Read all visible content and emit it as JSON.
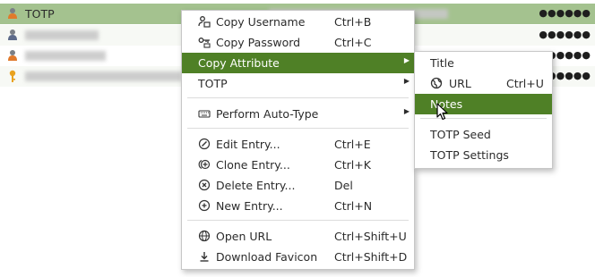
{
  "entries": [
    {
      "title": "TOTP",
      "password_mask": "●●●●●●"
    },
    {
      "title": "",
      "password_mask": "●●●●●●"
    },
    {
      "title": "",
      "password_mask": "●●●●●●"
    },
    {
      "title": "",
      "password_mask": "●●●●●●"
    }
  ],
  "context_menu": {
    "copy_username": {
      "label": "Copy Username",
      "shortcut": "Ctrl+B"
    },
    "copy_password": {
      "label": "Copy Password",
      "shortcut": "Ctrl+C"
    },
    "copy_attribute": {
      "label": "Copy Attribute"
    },
    "totp": {
      "label": "TOTP"
    },
    "auto_type": {
      "label": "Perform Auto-Type"
    },
    "edit_entry": {
      "label": "Edit Entry...",
      "shortcut": "Ctrl+E"
    },
    "clone_entry": {
      "label": "Clone Entry...",
      "shortcut": "Ctrl+K"
    },
    "delete_entry": {
      "label": "Delete Entry...",
      "shortcut": "Del"
    },
    "new_entry": {
      "label": "New Entry...",
      "shortcut": "Ctrl+N"
    },
    "open_url": {
      "label": "Open URL",
      "shortcut": "Ctrl+Shift+U"
    },
    "download_favicon": {
      "label": "Download Favicon",
      "shortcut": "Ctrl+Shift+D"
    }
  },
  "submenu": {
    "title": {
      "label": "Title"
    },
    "url": {
      "label": "URL",
      "shortcut": "Ctrl+U"
    },
    "notes": {
      "label": "Notes"
    },
    "totp_seed": {
      "label": "TOTP Seed"
    },
    "totp_settings": {
      "label": "TOTP Settings"
    }
  },
  "colors": {
    "selection": "#4f8026",
    "selected_row": "#a4c28f"
  }
}
